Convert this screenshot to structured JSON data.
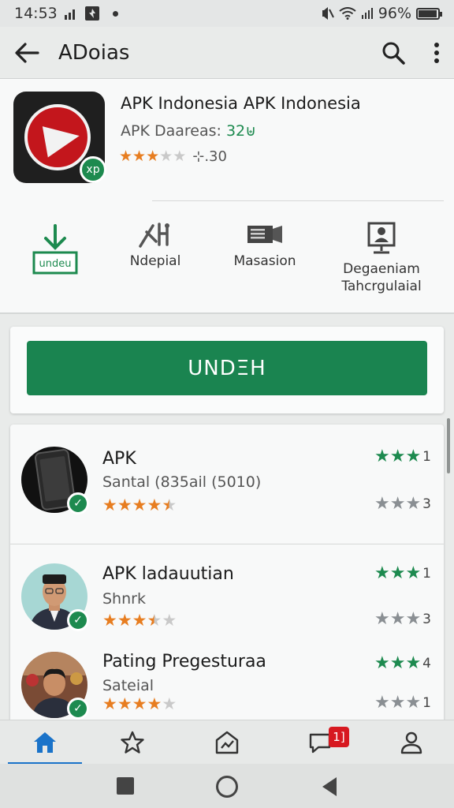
{
  "status_bar": {
    "time": "14:53",
    "battery": "96%",
    "battery_level": 0.96
  },
  "app_bar": {
    "title": "ADoias",
    "back_icon": "arrow-left-icon",
    "search_icon": "search-icon",
    "more_icon": "more-vertical-icon"
  },
  "app": {
    "name": "APK Indonesia APK Indonesia",
    "subtitle_prefix": "APK Daareas:",
    "subtitle_value": "32⊎",
    "rating_text": "⊹.30",
    "rating": 3,
    "icon_badge": "xp",
    "colors": {
      "icon_bg": "#1f1f1f",
      "icon_ring": "#c3161c",
      "brand_green": "#1a8450"
    }
  },
  "actions": [
    {
      "label": "",
      "icon": "download-icon",
      "icon_text": "undeu"
    },
    {
      "label": "Ndepial",
      "icon": "tools-icon"
    },
    {
      "label": "Masasion",
      "icon": "projector-icon"
    },
    {
      "label": "Degaeniam Tahcrgulaial",
      "icon": "monitor-person-icon"
    }
  ],
  "install_button": {
    "label": "UNDΞH"
  },
  "list": [
    {
      "title": "APK",
      "subtitle": "Santal (835ail (5010)",
      "rating": 4.5,
      "right_top": {
        "stars": 3,
        "count": "1",
        "color": "green"
      },
      "right_bottom": {
        "stars": 3,
        "count": "3",
        "color": "grey"
      }
    },
    {
      "title": "APK ladauutian",
      "subtitle": "Shnrk",
      "rating": 3.5,
      "right_top": {
        "stars": 3,
        "count": "1",
        "color": "green"
      },
      "right_bottom": {
        "stars": 3,
        "count": "3",
        "color": "grey"
      }
    },
    {
      "title": "Pating Pregesturaa",
      "subtitle": "Sateial",
      "rating": 4,
      "right_top": {
        "stars": 3,
        "count": "4",
        "color": "green"
      },
      "right_bottom": {
        "stars": 3,
        "count": "1",
        "color": "grey"
      }
    }
  ],
  "bottom_nav": [
    {
      "icon": "home-icon",
      "active": true
    },
    {
      "icon": "star-icon",
      "active": false
    },
    {
      "icon": "store-icon",
      "active": false
    },
    {
      "icon": "chat-icon",
      "active": false,
      "badge": "1]"
    },
    {
      "icon": "person-icon",
      "active": false
    }
  ],
  "system_nav": [
    "recents-icon",
    "home-circle-icon",
    "back-triangle-icon"
  ]
}
